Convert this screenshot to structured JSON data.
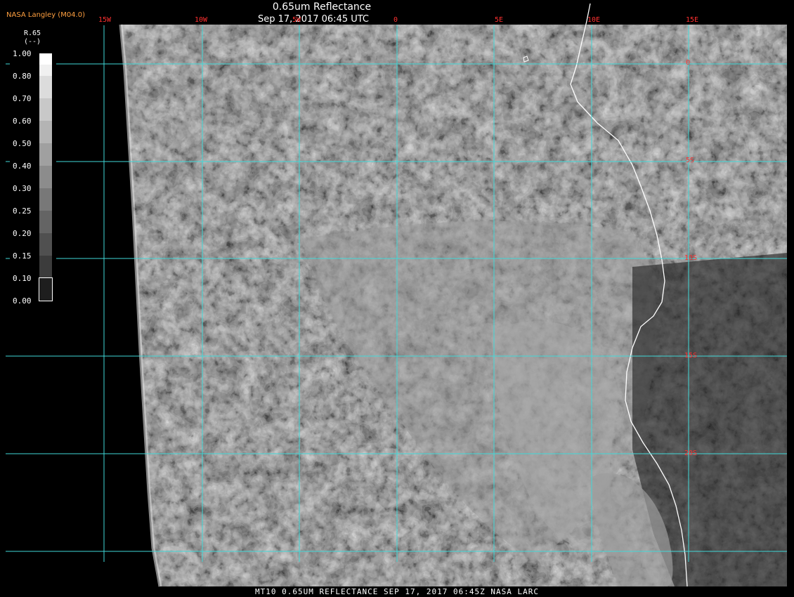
{
  "header": {
    "title": "0.65um Reflectance",
    "datetime": "Sep 17, 2017 06:45 UTC",
    "agency": "NASA Langley (M04.0)"
  },
  "longitudes": [
    "15W",
    "10W",
    "5W",
    "0",
    "5E",
    "10E",
    "15E"
  ],
  "latitudes": [
    "0",
    "5S",
    "10S",
    "15S",
    "20S"
  ],
  "legend": {
    "name": "R.65",
    "unit": "(--)",
    "ticks": [
      "1.00",
      "0.80",
      "0.70",
      "0.60",
      "0.50",
      "0.40",
      "0.30",
      "0.25",
      "0.20",
      "0.15",
      "0.10",
      "0.00"
    ]
  },
  "footer": {
    "caption": "MT10  0.65UM REFLECTANCE   SEP 17, 2017 06:45Z   NASA LARC"
  },
  "colors": {
    "grid": "#40d8d8",
    "coast": "#ffffff",
    "label_red": "#ff3030",
    "agency_orange": "#ffa040"
  }
}
